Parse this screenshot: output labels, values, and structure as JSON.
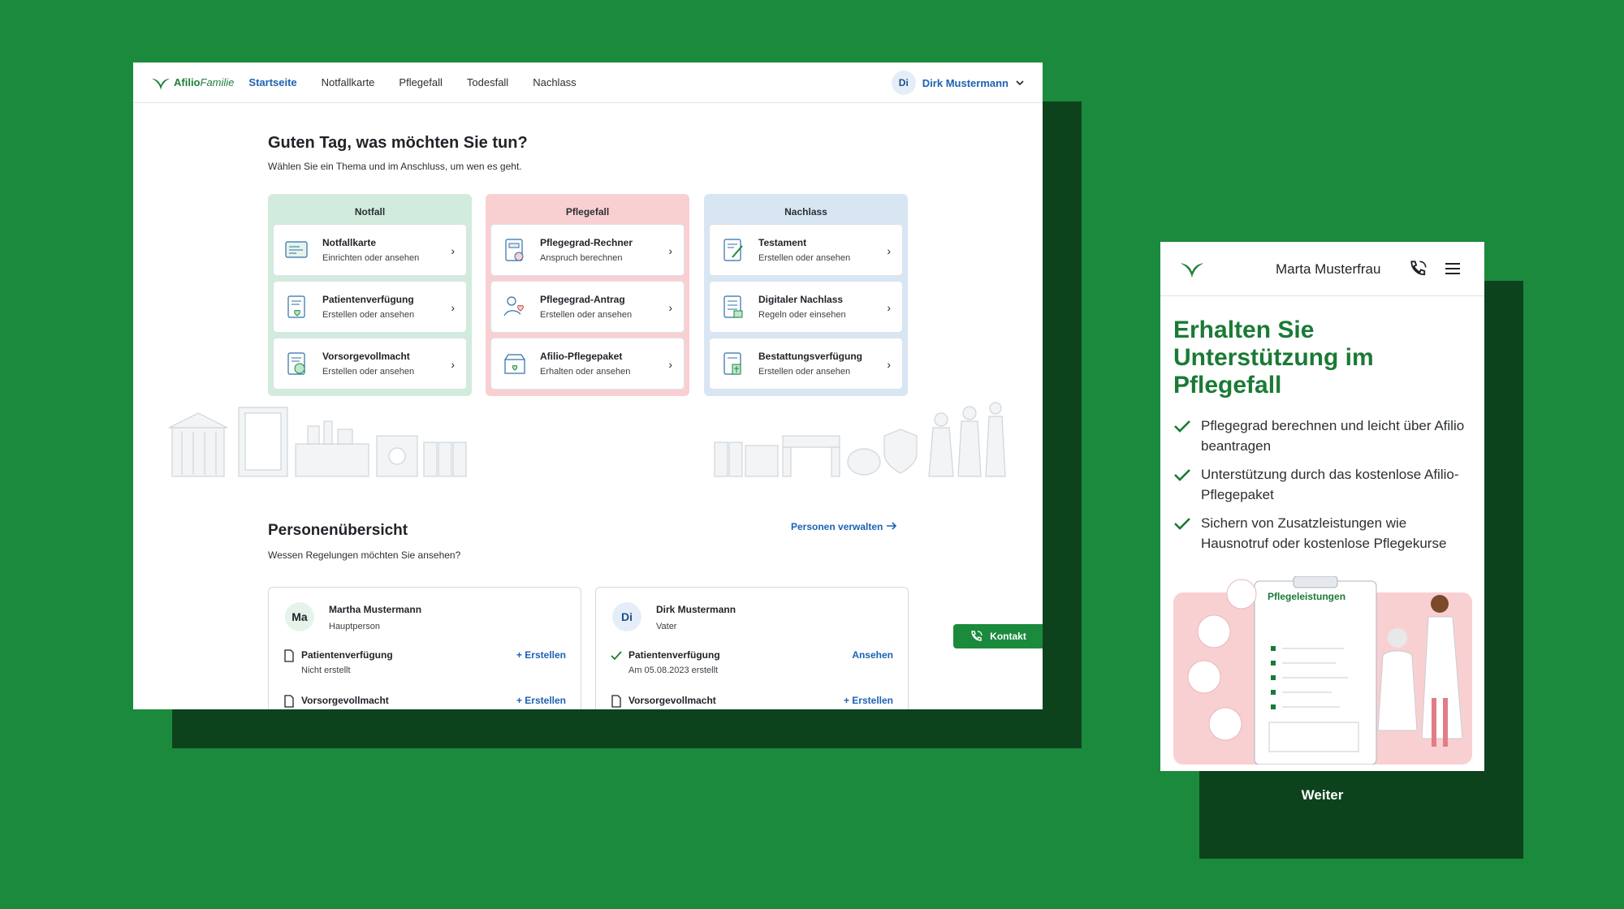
{
  "desktop": {
    "nav": {
      "logo_brand": "Afilio",
      "logo_suffix": "Familie",
      "items": [
        "Startseite",
        "Notfallkarte",
        "Pflegefall",
        "Todesfall",
        "Nachlass"
      ],
      "active": "Startseite",
      "user_initials": "Di",
      "user_name": "Dirk Mustermann"
    },
    "greeting": {
      "title": "Guten Tag, was möchten Sie tun?",
      "subtitle": "Wählen Sie ein Thema und im Anschluss, um wen es geht."
    },
    "columns": [
      {
        "title": "Notfall",
        "color": "#d1ecdd",
        "tiles": [
          {
            "title": "Notfallkarte",
            "sub": "Einrichten oder ansehen",
            "icon": "card-icon"
          },
          {
            "title": "Patientenverfügung",
            "sub": "Erstellen oder ansehen",
            "icon": "document-heart-icon"
          },
          {
            "title": "Vorsorgevollmacht",
            "sub": "Erstellen oder ansehen",
            "icon": "document-person-icon"
          }
        ]
      },
      {
        "title": "Pflegefall",
        "color": "#f9d0d2",
        "tiles": [
          {
            "title": "Pflegegrad-Rechner",
            "sub": "Anspruch berechnen",
            "icon": "calculator-doc-icon"
          },
          {
            "title": "Pflegegrad-Antrag",
            "sub": "Erstellen oder ansehen",
            "icon": "hand-heart-icon"
          },
          {
            "title": "Afilio-Pflegepaket",
            "sub": "Erhalten oder ansehen",
            "icon": "package-icon"
          }
        ]
      },
      {
        "title": "Nachlass",
        "color": "#d8e6f4",
        "tiles": [
          {
            "title": "Testament",
            "sub": "Erstellen oder ansehen",
            "icon": "document-pen-icon"
          },
          {
            "title": "Digitaler Nachlass",
            "sub": "Regeln oder einsehen",
            "icon": "document-list-icon"
          },
          {
            "title": "Bestattungsverfügung",
            "sub": "Erstellen oder ansehen",
            "icon": "document-cross-icon"
          }
        ]
      }
    ],
    "persons": {
      "title": "Personenübersicht",
      "subtitle": "Wessen Regelungen möchten Sie ansehen?",
      "manage_label": "Personen verwalten",
      "cards": [
        {
          "initials": "Ma",
          "name": "Martha Mustermann",
          "role": "Hauptperson",
          "rows": [
            {
              "title": "Patientenverfügung",
              "sub": "Nicht erstellt",
              "action": "Erstellen",
              "done": false
            },
            {
              "title": "Vorsorgevollmacht",
              "sub": "",
              "action": "Erstellen",
              "done": false
            }
          ]
        },
        {
          "initials": "Di",
          "name": "Dirk Mustermann",
          "role": "Vater",
          "rows": [
            {
              "title": "Patientenverfügung",
              "sub": "Am 05.08.2023 erstellt",
              "action": "Ansehen",
              "done": true
            },
            {
              "title": "Vorsorgevollmacht",
              "sub": "",
              "action": "Erstellen",
              "done": false
            }
          ]
        }
      ]
    },
    "contact_label": "Kontakt"
  },
  "mobile": {
    "user_name": "Marta Musterfrau",
    "headline": "Erhalten Sie Unterstützung im Pflegefall",
    "bullets": [
      "Pflegegrad berechnen und leicht über Afilio beantragen",
      "Unterstützung durch das kostenlose Afilio-Pflegepaket",
      "Sichern von Zusatzleistungen wie Hausnotruf oder kostenlose Pflegekurse"
    ],
    "illustration_label": "Pflegeleistungen",
    "next_label": "Weiter"
  },
  "colors": {
    "background": "#1b8a3d",
    "shadow": "#0d431c",
    "brand_green": "#1b7a35",
    "link_blue": "#1d62b3"
  }
}
